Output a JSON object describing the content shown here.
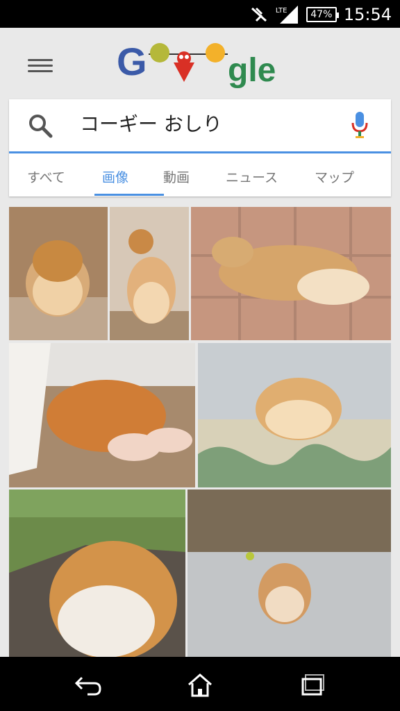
{
  "status_bar": {
    "network": "LTE",
    "battery": "47%",
    "time": "15:54"
  },
  "search": {
    "query": "コーギー おしり"
  },
  "tabs": [
    {
      "label": "すべて"
    },
    {
      "label": "画像"
    },
    {
      "label": "動画"
    },
    {
      "label": "ニュース"
    },
    {
      "label": "マップ"
    }
  ],
  "logo": {
    "letters": "gle"
  },
  "colors": {
    "accent": "#4a90e2",
    "google_blue": "#3b5aa8",
    "google_red": "#d93025",
    "google_green": "#2f8a4f",
    "google_yellow": "#f3b12a"
  }
}
